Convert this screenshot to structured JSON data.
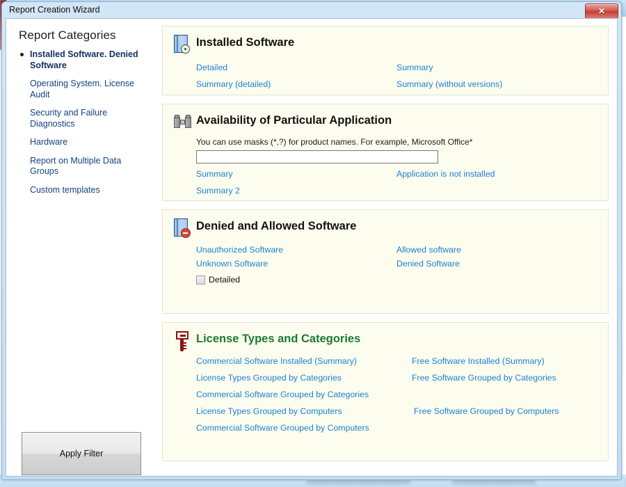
{
  "window": {
    "title": "Report Creation Wizard",
    "close_label": "✕"
  },
  "sidebar": {
    "title": "Report Categories",
    "items": [
      {
        "label": "Installed Software. Denied Software",
        "active": true
      },
      {
        "label": "Operating System. License Audit",
        "active": false
      },
      {
        "label": "Security and Failure Diagnostics",
        "active": false
      },
      {
        "label": "Hardware",
        "active": false
      },
      {
        "label": "Report on Multiple Data Groups",
        "active": false
      },
      {
        "label": "Custom templates",
        "active": false
      }
    ],
    "apply_filter_label": "Apply Filter"
  },
  "panels": {
    "installed_software": {
      "title": "Installed Software",
      "icon": "window-disc-icon",
      "left_links": [
        "Detailed",
        "Summary (detailed)"
      ],
      "right_links": [
        "Summary",
        "Summary (without versions)"
      ]
    },
    "availability": {
      "title": "Availability of Particular Application",
      "icon": "binoculars-icon",
      "hint": "You can use masks (*,?) for product names. For example, Microsoft Office*",
      "input_value": "",
      "input_placeholder": "",
      "left_links": [
        "Summary",
        "Summary 2"
      ],
      "right_links": [
        "Application is not installed"
      ]
    },
    "denied_allowed": {
      "title": "Denied and Allowed Software",
      "icon": "window-denied-icon",
      "left_links": [
        "Unauthorized Software",
        "Unknown Software"
      ],
      "right_links": [
        "Allowed software",
        "Denied Software"
      ],
      "checkbox_label": "Detailed",
      "checkbox_checked": false
    },
    "license_types": {
      "title": "License Types and Categories",
      "icon": "key-icon",
      "title_color": "#1a7a32",
      "left_links": [
        "Commercial Software Installed (Summary)",
        "License Types Grouped by Categories",
        "Commercial Software Grouped by Categories",
        "License Types Grouped by Computers",
        "Commercial Software Grouped by Computers"
      ],
      "right_links": [
        "Free Software Installed (Summary)",
        "Free Software Grouped by Categories",
        "",
        "Free Software Grouped by Computers"
      ]
    }
  },
  "colors": {
    "link": "#1a7fd4",
    "panel_bg": "#fdfdef",
    "sidebar_link": "#15417e",
    "accent_green": "#1a7a32",
    "close_red": "#c33b32"
  }
}
